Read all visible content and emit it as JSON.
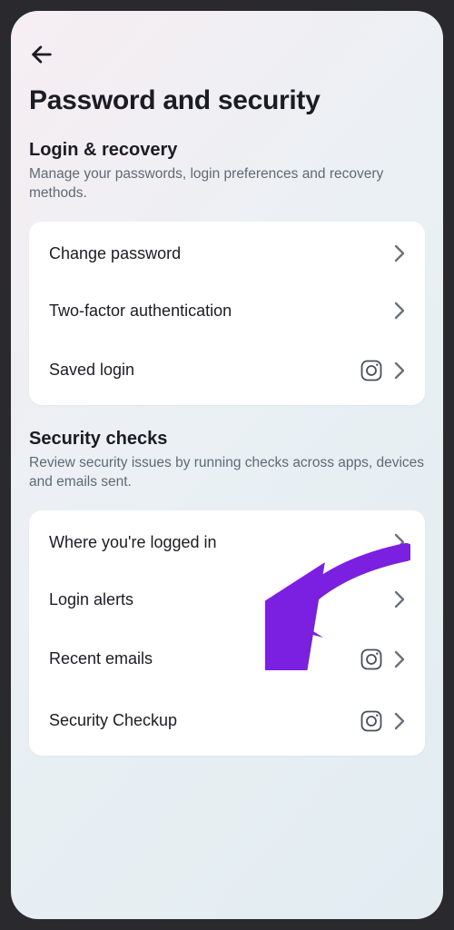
{
  "page": {
    "title": "Password and security"
  },
  "sections": {
    "login_recovery": {
      "heading": "Login & recovery",
      "desc": "Manage your passwords, login preferences and recovery methods.",
      "items": [
        {
          "label": "Change password"
        },
        {
          "label": "Two-factor authentication"
        },
        {
          "label": "Saved login"
        }
      ]
    },
    "security_checks": {
      "heading": "Security checks",
      "desc": "Review security issues by running checks across apps, devices and emails sent.",
      "items": [
        {
          "label": "Where you're logged in"
        },
        {
          "label": "Login alerts"
        },
        {
          "label": "Recent emails"
        },
        {
          "label": "Security Checkup"
        }
      ]
    }
  },
  "annotationColor": "#7b1fe0"
}
